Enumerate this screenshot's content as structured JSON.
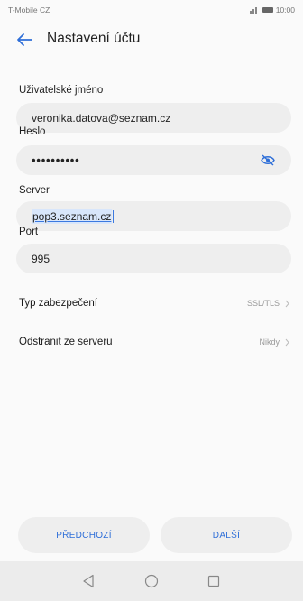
{
  "status_bar": {
    "carrier": "T-Mobile CZ",
    "time": "10:00"
  },
  "header": {
    "title": "Nastavení účtu"
  },
  "form": {
    "username_label": "Uživatelské jméno",
    "username_value": "veronika.datova@seznam.cz",
    "password_label": "Heslo",
    "password_value": "••••••••••",
    "server_label": "Server",
    "server_value": "pop3.seznam.cz",
    "port_label": "Port",
    "port_value": "995"
  },
  "settings": {
    "security_label": "Typ zabezpečení",
    "security_value": "SSL/TLS",
    "delete_label": "Odstranit ze serveru",
    "delete_value": "Nikdy"
  },
  "buttons": {
    "previous_label": "PŘEDCHOZÍ",
    "next_label": "DALŠÍ"
  },
  "colors": {
    "accent": "#2f6fd8",
    "field_bg": "#eeeeee"
  },
  "icons": {
    "back": "arrow-left-icon",
    "visibility": "eye-off-icon",
    "nav_back": "triangle-back-icon",
    "nav_home": "circle-home-icon",
    "nav_recent": "square-recent-icon"
  }
}
